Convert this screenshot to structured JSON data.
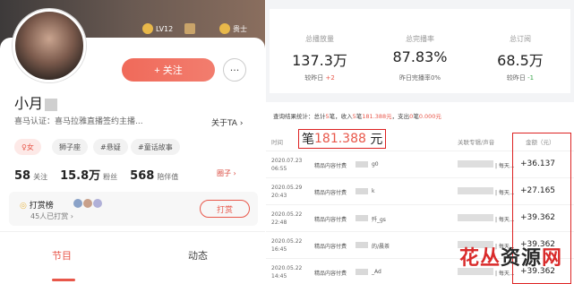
{
  "profile": {
    "level_badge": "LV12",
    "vip_badge": "贵士",
    "follow_label": "+ 关注",
    "chat_icon": "chat-bubble-icon",
    "name": "小月",
    "verification": "喜马认证：喜马拉雅直播签约主播...",
    "about": "关于TA ›",
    "tags": [
      "♀女",
      "狮子座",
      "#悬疑",
      "#童话故事"
    ],
    "stats": [
      {
        "value": "58",
        "label": "关注"
      },
      {
        "value": "15.8万",
        "label": "粉丝"
      },
      {
        "value": "568",
        "label": "陪伴值"
      }
    ],
    "circle_link": "圈子 ›",
    "reward": {
      "title": "打赏榜",
      "subtitle": "45人已打赏 ›",
      "button": "打赏"
    },
    "tabs": [
      "节目",
      "动态"
    ]
  },
  "summary": [
    {
      "label": "总播放量",
      "value": "137.3万",
      "note_prefix": "较昨日 ",
      "note_value": "+2",
      "note_color": "red"
    },
    {
      "label": "总完播率",
      "value": "87.83%",
      "note_prefix": "昨日完播率",
      "note_value": "0%",
      "note_color": "plain"
    },
    {
      "label": "总订阅",
      "value": "68.5万",
      "note_prefix": "较昨日 ",
      "note_value": "-1",
      "note_color": "green"
    }
  ],
  "ledger": {
    "query_prefix": "查询结果统计：总计",
    "query_count": "5",
    "query_mid": "笔，收入",
    "query_income_count": "5",
    "query_income_label": "笔",
    "query_income_amount": "181.388元",
    "query_out": "，支出",
    "query_out_count": "0",
    "query_out_label": "笔",
    "query_out_amount": "0.000元",
    "highlight_prefix": "笔",
    "highlight_amount": "181.388",
    "highlight_suffix": "元",
    "col_time": "时间",
    "col_album": "关联专辑/声音",
    "col_amount": "金额（元）",
    "rows": [
      {
        "date": "2020.07.23",
        "time": "06:55",
        "desc": "精品内容付费",
        "user": "g0",
        "album": "| 每天...",
        "amount": "+36.137"
      },
      {
        "date": "2020.05.29",
        "time": "20:43",
        "desc": "精品内容付费",
        "user": "k",
        "album": "| 每天...",
        "amount": "+27.165"
      },
      {
        "date": "2020.05.22",
        "time": "22:48",
        "desc": "精品内容付费",
        "user": "歼_gs",
        "album": "| 每天...",
        "amount": "+39.362"
      },
      {
        "date": "2020.05.22",
        "time": "16:45",
        "desc": "精品内容付费",
        "user": "的/晨茶",
        "album": "| 每天...",
        "amount": "+39.362"
      },
      {
        "date": "2020.05.22",
        "time": "14:45",
        "desc": "精品内容付费",
        "user": "_Ad",
        "album": "| 每天...",
        "amount": "+39.362"
      }
    ]
  },
  "watermark": {
    "part1": "花丛",
    "part2": "资源",
    "part3": "网"
  }
}
